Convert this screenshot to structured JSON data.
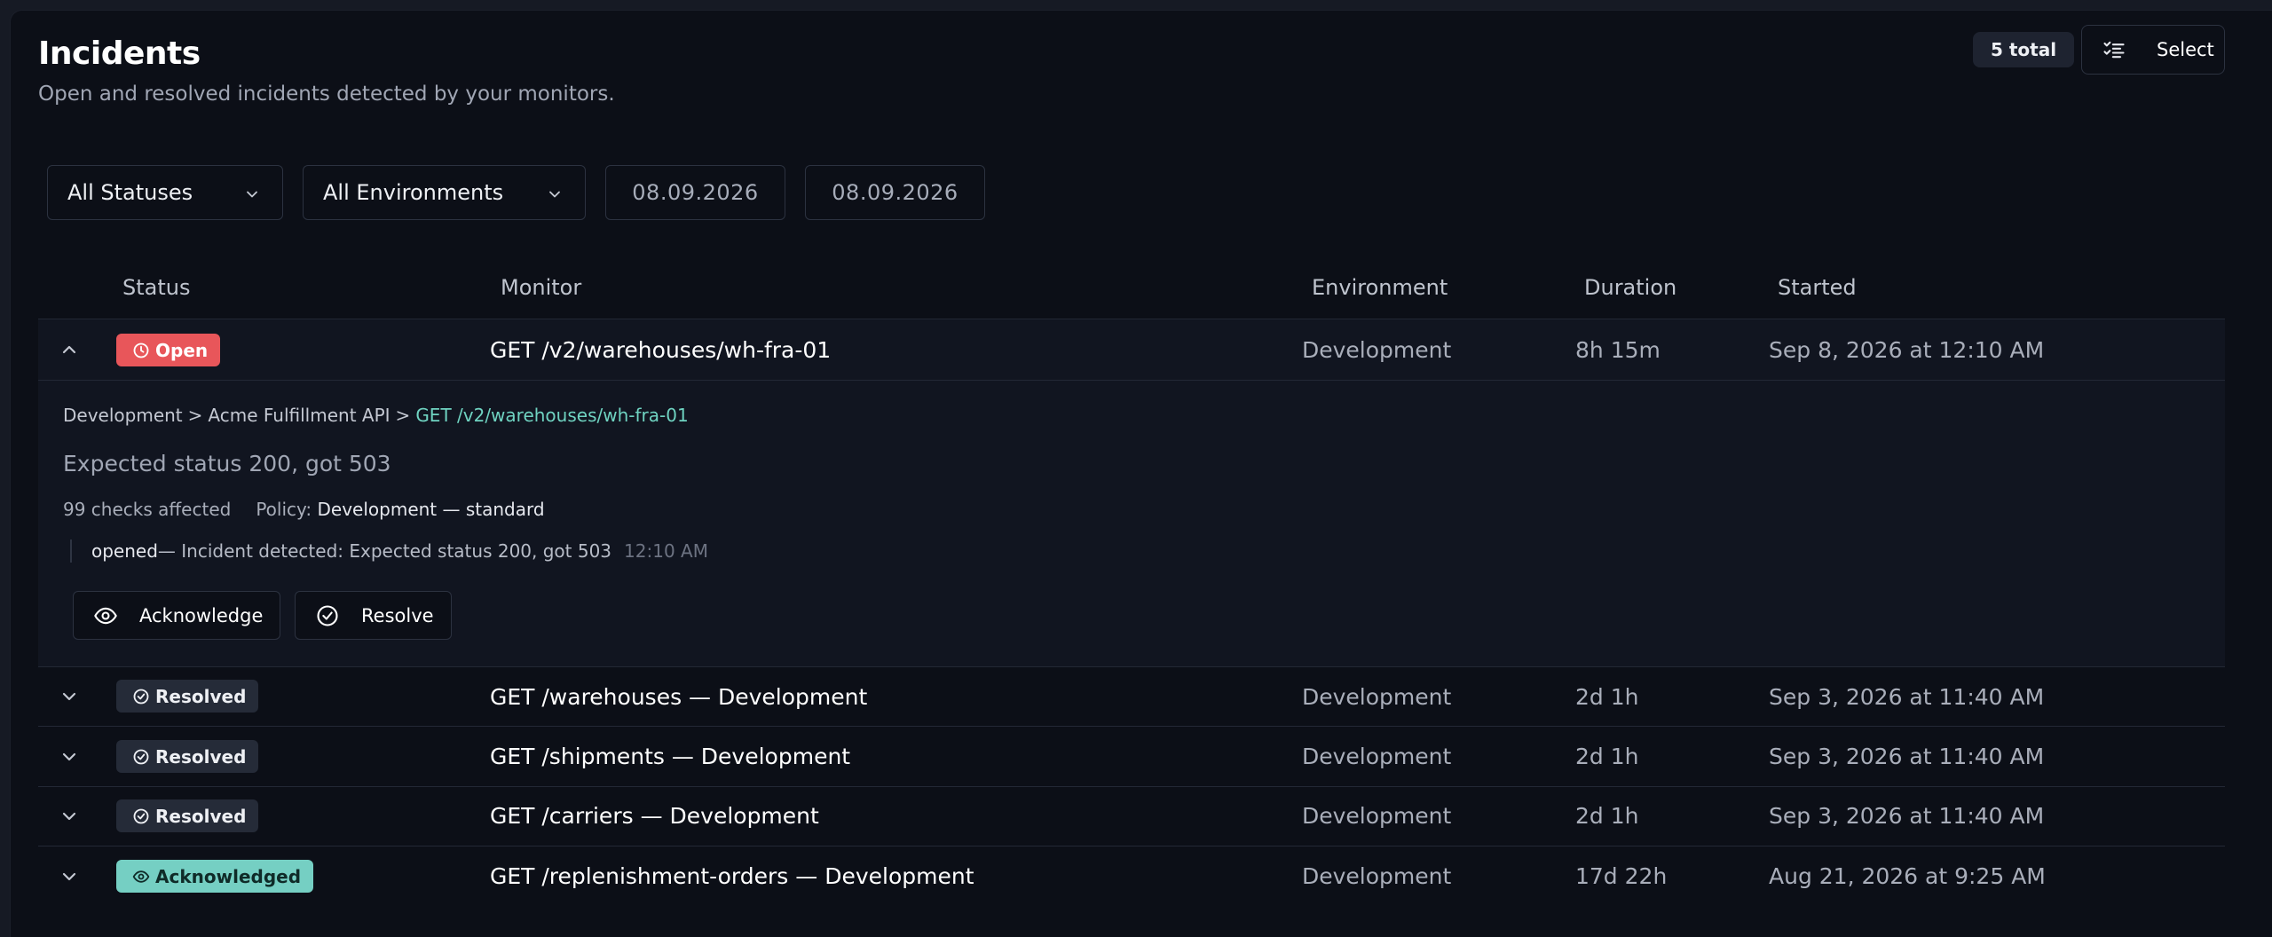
{
  "header": {
    "title": "Incidents",
    "subtitle": "Open and resolved incidents detected by your monitors.",
    "total_badge": "5 total",
    "select_label": "Select"
  },
  "filters": {
    "status": "All Statuses",
    "environment": "All Environments",
    "date_from": "08.09.2026",
    "date_to": "08.09.2026"
  },
  "table": {
    "columns": {
      "status": "Status",
      "monitor": "Monitor",
      "environment": "Environment",
      "duration": "Duration",
      "started": "Started"
    },
    "rows": [
      {
        "status": "Open",
        "monitor": "GET /v2/warehouses/wh-fra-01",
        "environment": "Development",
        "duration": "8h 15m",
        "started": "Sep 8, 2026 at 12:10 AM",
        "expanded": true
      },
      {
        "status": "Resolved",
        "monitor": "GET /warehouses — Development",
        "environment": "Development",
        "duration": "2d 1h",
        "started": "Sep 3, 2026 at 11:40 AM"
      },
      {
        "status": "Resolved",
        "monitor": "GET /shipments — Development",
        "environment": "Development",
        "duration": "2d 1h",
        "started": "Sep 3, 2026 at 11:40 AM"
      },
      {
        "status": "Resolved",
        "monitor": "GET /carriers — Development",
        "environment": "Development",
        "duration": "2d 1h",
        "started": "Sep 3, 2026 at 11:40 AM"
      },
      {
        "status": "Acknowledged",
        "monitor": "GET /replenishment-orders — Development",
        "environment": "Development",
        "duration": "17d 22h",
        "started": "Aug 21, 2026 at 9:25 AM"
      }
    ]
  },
  "detail": {
    "breadcrumb": [
      "Development",
      "Acme Fulfillment API",
      "GET /v2/warehouses/wh-fra-01"
    ],
    "breadcrumb_sep": ">",
    "message": "Expected status 200, got 503",
    "checks_affected": "99 checks affected",
    "policy_label": "Policy:",
    "policy_value": "Development — standard",
    "timeline": {
      "event": "opened",
      "text": " — Incident detected: Expected status 200, got 503",
      "time": "12:10 AM"
    },
    "acknowledge_label": "Acknowledge",
    "resolve_label": "Resolve"
  },
  "colors": {
    "open": "#e8565a",
    "resolved": "#252b38",
    "acknowledged": "#75cfc3",
    "link": "#6fd3c1"
  },
  "icons": {
    "select": "checklist-icon",
    "open": "clock-icon",
    "resolved": "check-circle-icon",
    "acknowledged": "eye-icon",
    "expand": "chevron-down-icon",
    "collapse": "chevron-up-icon"
  }
}
